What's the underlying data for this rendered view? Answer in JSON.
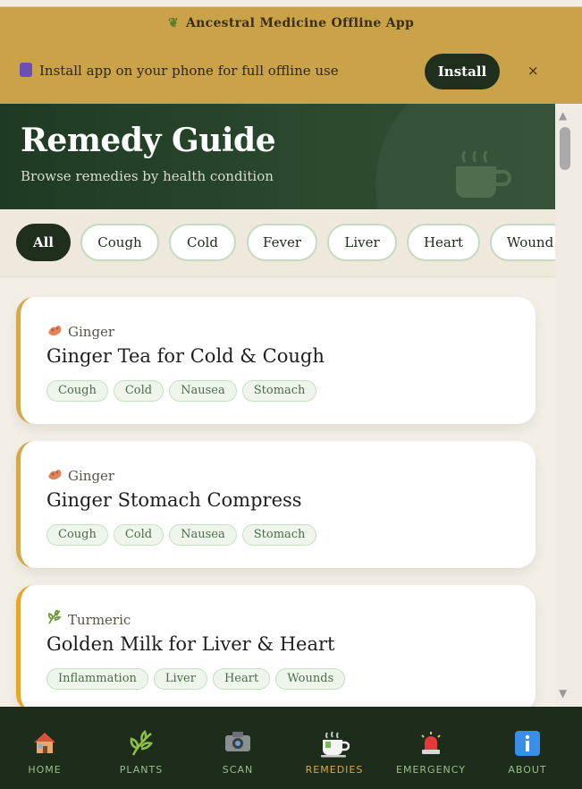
{
  "banner": {
    "title": "Ancestral Medicine Offline App",
    "install_text": "Install app on your phone for full offline use",
    "install_button": "Install",
    "close": "×"
  },
  "hero": {
    "title": "Remedy Guide",
    "subtitle": "Browse remedies by health condition"
  },
  "filters": [
    "All",
    "Cough",
    "Cold",
    "Fever",
    "Liver",
    "Heart",
    "Wound"
  ],
  "active_filter": "All",
  "remedies": [
    {
      "herb": "Ginger",
      "herb_icon": "ginger-icon",
      "title": "Ginger Tea for Cold & Cough",
      "tags": [
        "Cough",
        "Cold",
        "Nausea",
        "Stomach"
      ]
    },
    {
      "herb": "Ginger",
      "herb_icon": "ginger-icon",
      "title": "Ginger Stomach Compress",
      "tags": [
        "Cough",
        "Cold",
        "Nausea",
        "Stomach"
      ]
    },
    {
      "herb": "Turmeric",
      "herb_icon": "turmeric-leaf-icon",
      "title": "Golden Milk for Liver & Heart",
      "tags": [
        "Inflammation",
        "Liver",
        "Heart",
        "Wounds"
      ]
    }
  ],
  "nav": [
    {
      "label": "HOME",
      "icon": "house-icon"
    },
    {
      "label": "PLANTS",
      "icon": "plant-icon"
    },
    {
      "label": "SCAN",
      "icon": "camera-icon"
    },
    {
      "label": "REMEDIES",
      "icon": "tea-cup-icon"
    },
    {
      "label": "EMERGENCY",
      "icon": "siren-icon"
    },
    {
      "label": "ABOUT",
      "icon": "info-icon"
    }
  ],
  "active_nav": "REMEDIES",
  "colors": {
    "banner": "#c9a24a",
    "hero": "#1f3a24",
    "nav_bg": "#1d2c1b",
    "accent": "#d9a94a"
  }
}
